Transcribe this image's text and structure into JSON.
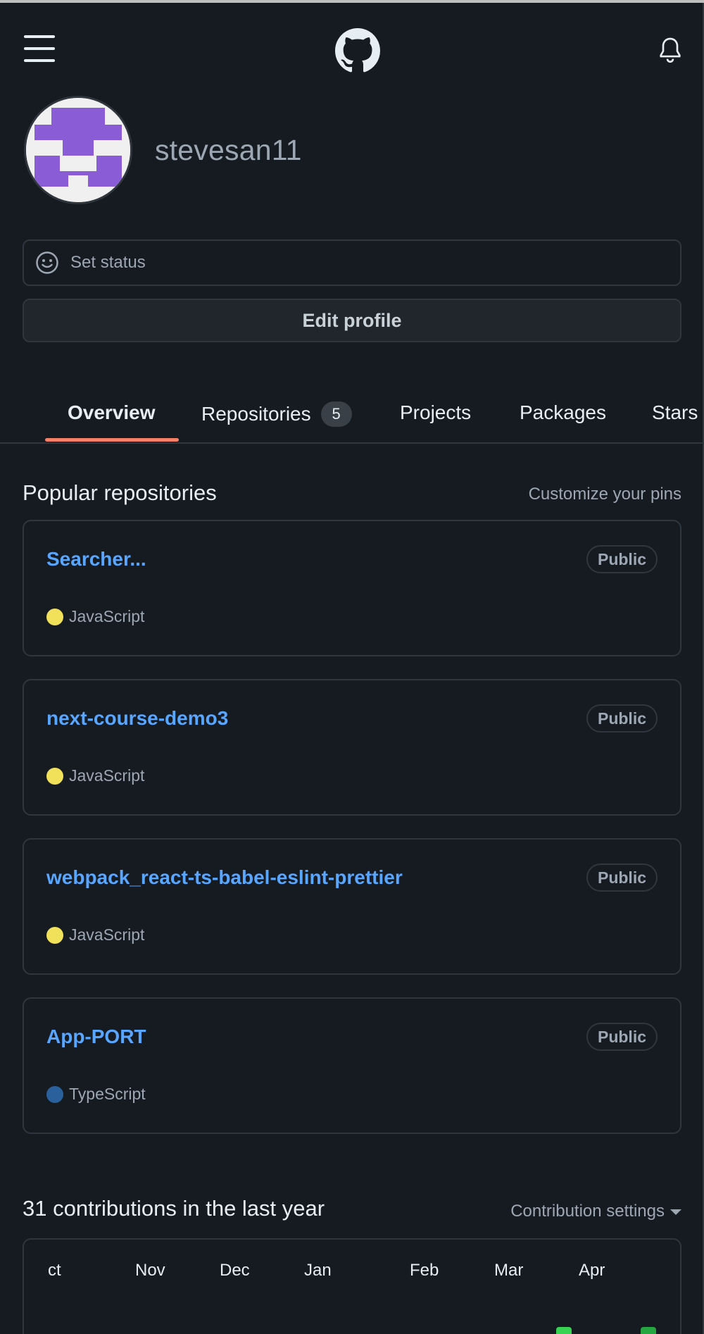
{
  "header": {
    "menu_icon": "hamburger-icon",
    "logo_icon": "github-logo-icon",
    "notification_icon": "bell-icon"
  },
  "profile": {
    "username": "stevesan11",
    "status_placeholder": "Set status",
    "edit_profile_label": "Edit profile"
  },
  "tabs": [
    {
      "label": "Overview",
      "active": true
    },
    {
      "label": "Repositories",
      "count": "5"
    },
    {
      "label": "Projects"
    },
    {
      "label": "Packages"
    },
    {
      "label": "Stars"
    }
  ],
  "popular": {
    "title": "Popular repositories",
    "customize_label": "Customize your pins",
    "repos": [
      {
        "name": "Searcher...",
        "visibility": "Public",
        "language": "JavaScript",
        "lang_color": "#f1e05a"
      },
      {
        "name": "next-course-demo3",
        "visibility": "Public",
        "language": "JavaScript",
        "lang_color": "#f1e05a"
      },
      {
        "name": "webpack_react-ts-babel-eslint-prettier",
        "visibility": "Public",
        "language": "JavaScript",
        "lang_color": "#f1e05a"
      },
      {
        "name": "App-PORT",
        "visibility": "Public",
        "language": "TypeScript",
        "lang_color": "#3178c6"
      }
    ]
  },
  "contributions": {
    "title": "31 contributions in the last year",
    "settings_label": "Contribution settings",
    "months": [
      "ct",
      "Nov",
      "Dec",
      "Jan",
      "Feb",
      "Mar",
      "Apr"
    ]
  },
  "colors": {
    "background": "#161b22",
    "border": "#30363d",
    "link": "#58a6ff",
    "muted": "#9da7b3",
    "tab_underline": "#f78166",
    "avatar_identicon": "#8a5cd6",
    "contrib_green": "#39d353"
  }
}
